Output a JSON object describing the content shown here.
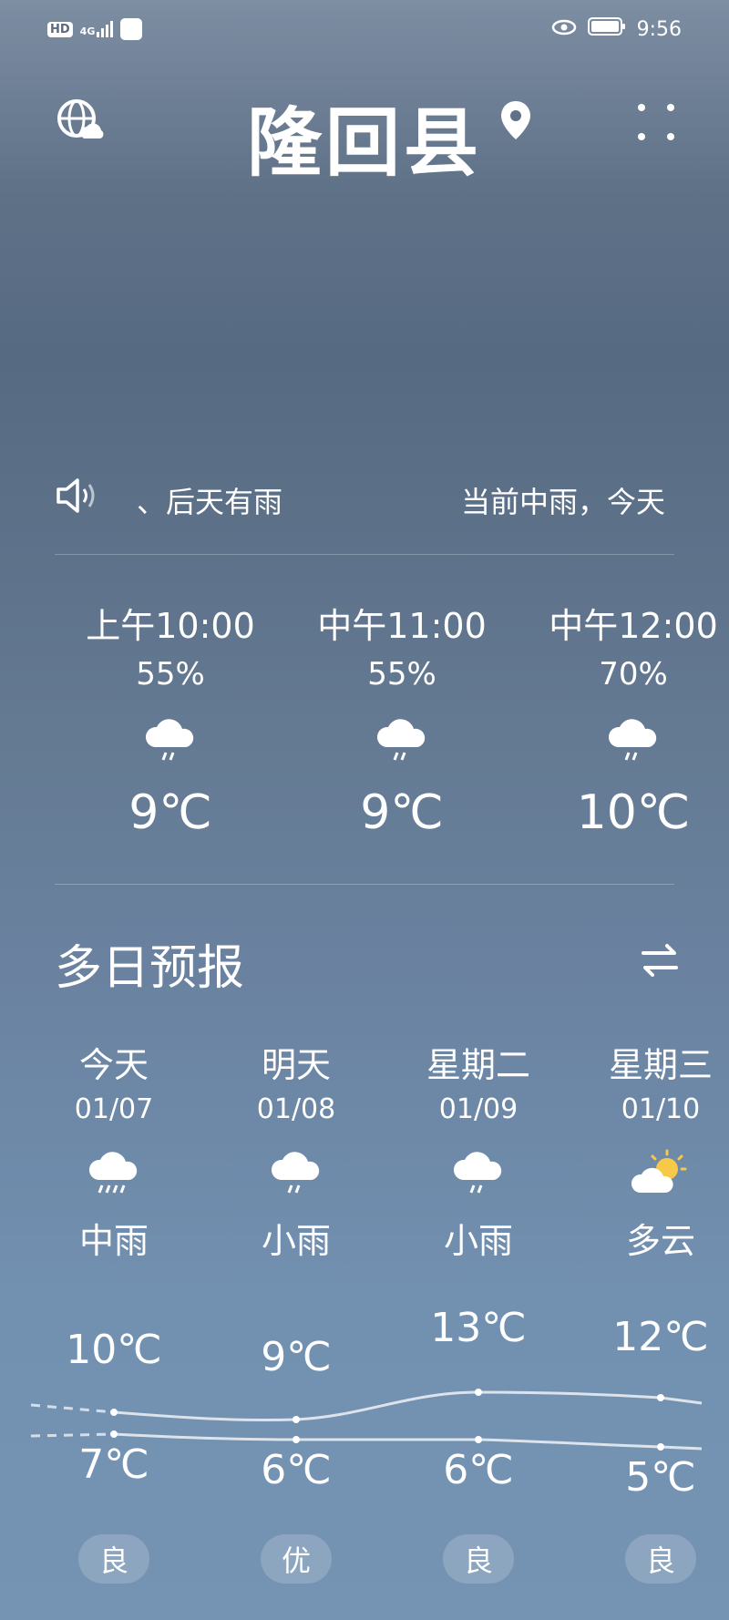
{
  "status_bar": {
    "network_badge": "HD",
    "signal": "4G",
    "time": "9:56"
  },
  "header": {
    "city": "隆回县",
    "left_icon": "globe-cloud-icon",
    "location_icon": "location-pin-icon",
    "menu_icon": "dots-grid-icon"
  },
  "broadcast": {
    "icon": "speaker-icon",
    "text_left": "、后天有雨",
    "text_right": "当前中雨，今天"
  },
  "hourly": [
    {
      "time": "上午10:00",
      "precip": "55%",
      "icon": "rain-cloud-icon",
      "temp": "9℃"
    },
    {
      "time": "中午11:00",
      "precip": "55%",
      "icon": "rain-cloud-icon",
      "temp": "9℃"
    },
    {
      "time": "中午12:00",
      "precip": "70%",
      "icon": "rain-cloud-icon",
      "temp": "10℃"
    }
  ],
  "daily": {
    "title": "多日预报",
    "switch_icon": "swap-arrows-icon",
    "days": [
      {
        "name": "今天",
        "date": "01/07",
        "icon": "moderate-rain-icon",
        "cond": "中雨",
        "high": "10℃",
        "low": "7℃",
        "aqi": "良"
      },
      {
        "name": "明天",
        "date": "01/08",
        "icon": "light-rain-icon",
        "cond": "小雨",
        "high": "9℃",
        "low": "6℃",
        "aqi": "优"
      },
      {
        "name": "星期二",
        "date": "01/09",
        "icon": "light-rain-icon",
        "cond": "小雨",
        "high": "13℃",
        "low": "6℃",
        "aqi": "良"
      },
      {
        "name": "星期三",
        "date": "01/10",
        "icon": "partly-cloudy-icon",
        "cond": "多云",
        "high": "12℃",
        "low": "5℃",
        "aqi": "良"
      }
    ]
  }
}
